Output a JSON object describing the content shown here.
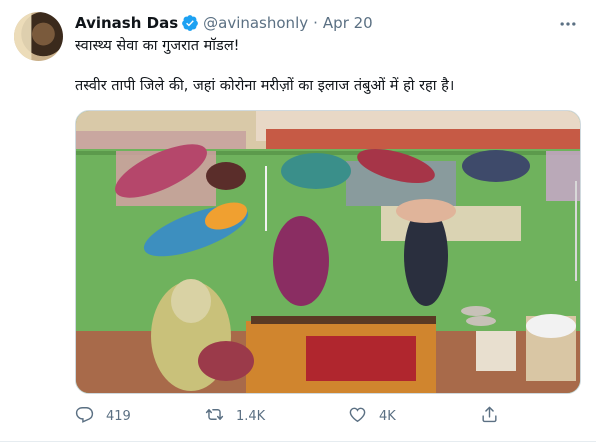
{
  "tweet": {
    "author_name": "Avinash Das",
    "author_handle": "@avinashonly",
    "separator": "·",
    "timestamp": "Apr 20",
    "text_line1": "स्वास्थ्य सेवा का गुजरात मॉडल!",
    "text_line2": "तस्वीर तापी जिले की, जहां कोरोना मरीज़ों का इलाज तंबुओं में हो रहा है।"
  },
  "actions": {
    "replies": "419",
    "retweets": "1.4K",
    "likes": "4K"
  },
  "icons": {
    "verified": "verified-badge-icon",
    "more": "more-options-icon",
    "reply": "reply-icon",
    "retweet": "retweet-icon",
    "like": "like-icon",
    "share": "share-icon"
  },
  "colors": {
    "verified": "#1da1f2",
    "secondary_text": "#5b7083",
    "primary_text": "#0f1419"
  }
}
